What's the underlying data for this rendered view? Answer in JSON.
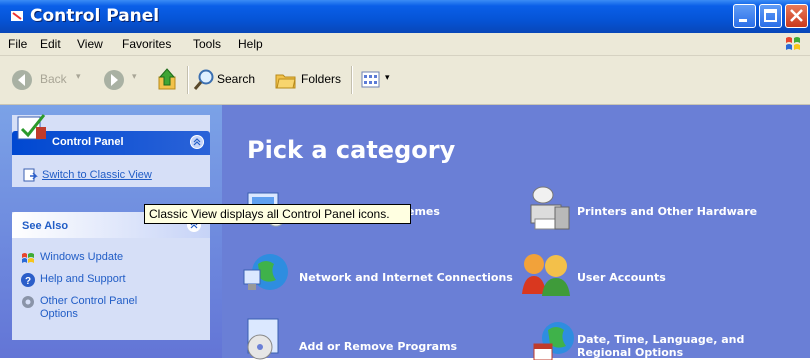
{
  "window": {
    "title": "Control Panel"
  },
  "menu": [
    "File",
    "Edit",
    "View",
    "Favorites",
    "Tools",
    "Help"
  ],
  "toolbar": {
    "back": "Back",
    "search": "Search",
    "folders": "Folders"
  },
  "taskpane": {
    "panel1_title": "Control Panel",
    "switch_link": "Switch to Classic View",
    "see_also_title": "See Also",
    "links": [
      "Windows Update",
      "Help and Support",
      "Other Control Panel Options"
    ]
  },
  "content": {
    "heading": "Pick a category",
    "categories": [
      "emes",
      "Printers and Other Hardware",
      "Network and Internet Connections",
      "User Accounts",
      "Add or Remove Programs",
      "Date, Time, Language, and Regional Options"
    ]
  },
  "tooltip": "Classic View displays all Control Panel icons.",
  "colors": {
    "title_bar": "#0654d6",
    "task_pane": "#7ba2e7",
    "content_bg": "#6a7fd6",
    "link": "#215dc6",
    "tooltip_bg": "#ffffe1"
  }
}
